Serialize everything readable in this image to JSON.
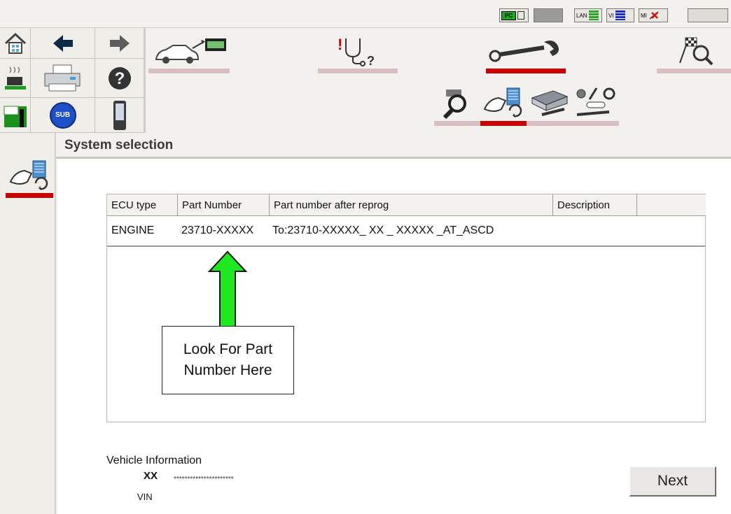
{
  "status": {
    "pc_label": "PC",
    "lan_label": "LAN",
    "vi_label": "VI",
    "mi_label": "MI"
  },
  "toolbar": {
    "sub_label": "SUB"
  },
  "page": {
    "title": "System selection"
  },
  "table": {
    "headers": [
      "ECU type",
      "Part Number",
      "Part number after reprog",
      "Description",
      ""
    ],
    "rows": [
      {
        "ecu_type": "ENGINE",
        "part_number": "23710-XXXXX",
        "part_after_reprog": "To:23710-XXXXX_ XX _ XXXXX _AT_ASCD",
        "description": ""
      }
    ]
  },
  "annotation": {
    "line1": "Look For Part",
    "line2": "Number Here",
    "arrow_color": "#1ee81e"
  },
  "vehicle": {
    "label": "Vehicle Information",
    "model": "XX",
    "vin_value": "**********************",
    "vin_label": "VIN"
  },
  "buttons": {
    "next": "Next"
  },
  "colors": {
    "active_red": "#cc0000",
    "inactive_pink": "#d8bfc1"
  }
}
